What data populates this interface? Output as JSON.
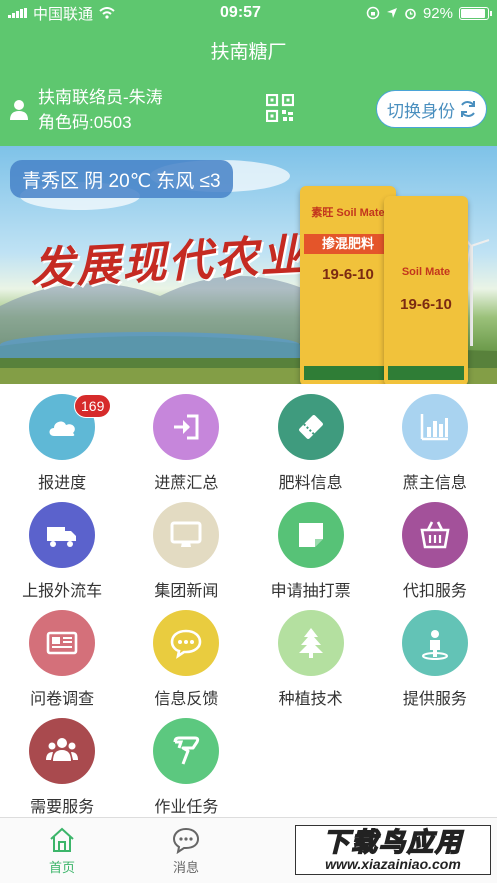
{
  "status_bar": {
    "carrier": "中国联通",
    "time": "09:57",
    "battery": "92%",
    "battery_level": 0.92
  },
  "app": {
    "title": "扶南糖厂"
  },
  "user": {
    "name": "扶南联络员-朱涛",
    "role": "角色码:0503",
    "switch_label": "切换身份"
  },
  "banner": {
    "weather": "青秀区 阴 20℃ 东风 ≤3",
    "slogan": "发展现代农业",
    "bag_brand": "素旺 Soil Mate",
    "bag_name": "掺混肥料",
    "bag_npk": "19-6-10",
    "bag2_brand": "Soil Mate",
    "bag2_npk": "19-6-10"
  },
  "menu": [
    {
      "label": "报进度",
      "icon": "cloud-icon",
      "color": "#5fb8d6",
      "badge": "169"
    },
    {
      "label": "进蔗汇总",
      "icon": "login-icon",
      "color": "#c686db"
    },
    {
      "label": "肥料信息",
      "icon": "ticket-icon",
      "color": "#3f9b7e"
    },
    {
      "label": "蔗主信息",
      "icon": "bar-chart-icon",
      "color": "#a9d3f0"
    },
    {
      "label": "上报外流车",
      "icon": "truck-icon",
      "color": "#5b62cc"
    },
    {
      "label": "集团新闻",
      "icon": "monitor-icon",
      "color": "#e3dbc2"
    },
    {
      "label": "申请抽打票",
      "icon": "note-icon",
      "color": "#57c277"
    },
    {
      "label": "代扣服务",
      "icon": "basket-icon",
      "color": "#a3519a"
    },
    {
      "label": "问卷调查",
      "icon": "newspaper-icon",
      "color": "#d4707a"
    },
    {
      "label": "信息反馈",
      "icon": "chat-icon",
      "color": "#e9cc3f"
    },
    {
      "label": "种植技术",
      "icon": "tree-icon",
      "color": "#b4e0a0"
    },
    {
      "label": "提供服务",
      "icon": "person-icon",
      "color": "#63c3b6"
    },
    {
      "label": "需要服务",
      "icon": "group-icon",
      "color": "#a94a4e"
    },
    {
      "label": "作业任务",
      "icon": "task-icon",
      "color": "#5cc87f"
    }
  ],
  "tabs": [
    {
      "label": "首页",
      "icon": "home-icon"
    },
    {
      "label": "消息",
      "icon": "message-icon"
    }
  ],
  "watermark": {
    "text": "下载鸟应用",
    "url": "www.xiazainiao.com"
  }
}
